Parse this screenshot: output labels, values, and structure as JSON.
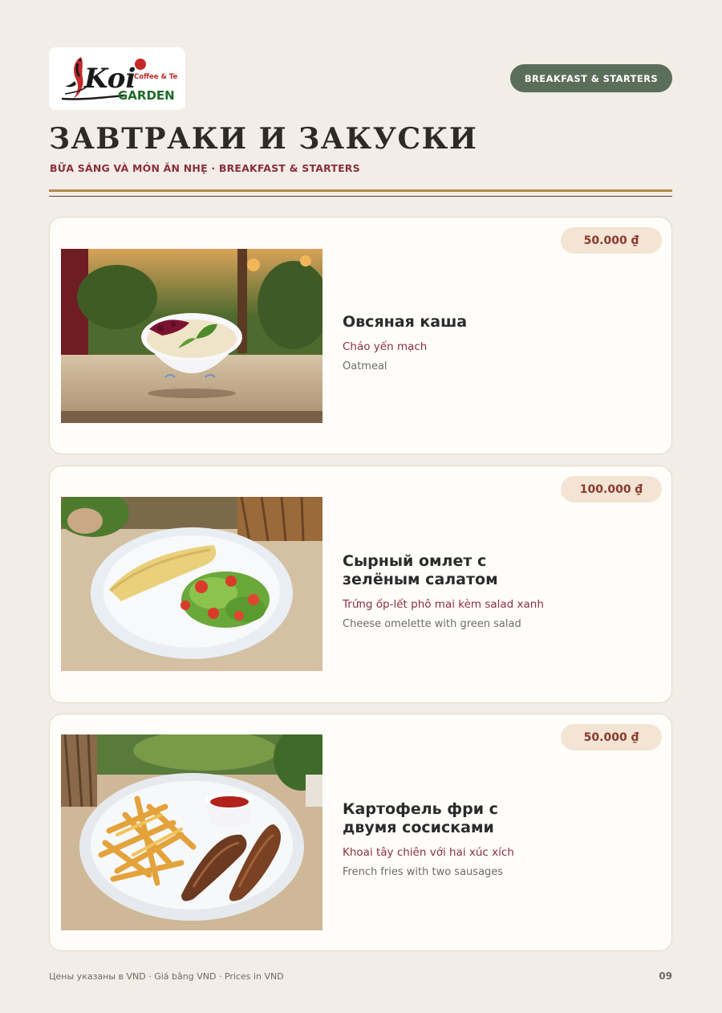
{
  "header": {
    "logo": {
      "script": "Koi",
      "tagline": "Coffee & Tea",
      "name": "GARDEN"
    },
    "category_pill": "BREAKFAST & STARTERS",
    "title": "ЗАВТРАКИ И ЗАКУСКИ",
    "subtitle": "BỮA SÁNG VÀ MÓN ĂN NHẸ · BREAKFAST & STARTERS"
  },
  "items": [
    {
      "price": "50.000 ₫",
      "name_ru": "Овсяная каша",
      "name_vi": "Cháo yến mạch",
      "name_en": "Oatmeal",
      "photo_icon": "oatmeal-bowl-photo"
    },
    {
      "price": "100.000 ₫",
      "name_ru": "Сырный омлет с зелёным салатом",
      "name_vi": "Trứng ốp-lết phô mai kèm salad xanh",
      "name_en": "Cheese omelette with green salad",
      "photo_icon": "omelette-plate-photo"
    },
    {
      "price": "50.000 ₫",
      "name_ru": "Картофель фри с двумя сосисками",
      "name_vi": "Khoai tây chiên với hai xúc xích",
      "name_en": "French fries with two sausages",
      "photo_icon": "fries-sausages-photo"
    }
  ],
  "footer": {
    "note": "Цены указаны в VND · Giá bằng VND · Prices in VND",
    "page_number": "09"
  },
  "colors": {
    "background": "#f2ede6",
    "accent_green": "#5b6e5a",
    "accent_red": "#8a2f3d",
    "gold_rule": "#b4874b",
    "price_pill": "#f3e4d3"
  }
}
